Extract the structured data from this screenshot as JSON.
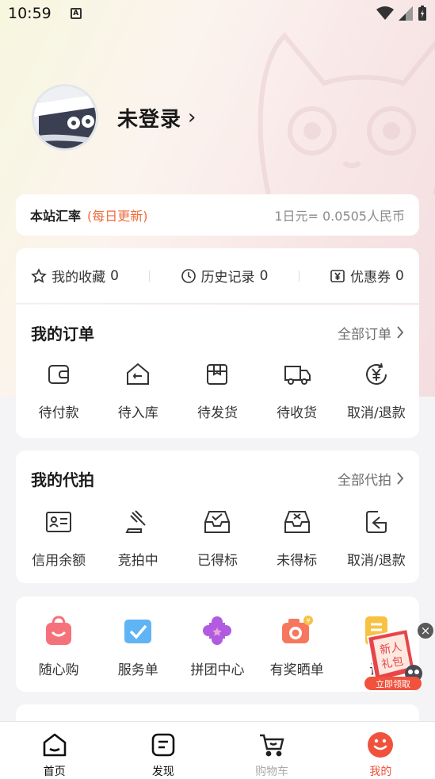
{
  "status_bar": {
    "time": "10:59",
    "badge": "A"
  },
  "profile": {
    "login_label": "未登录",
    "chevron": "›"
  },
  "rate": {
    "title": "本站汇率",
    "hint": "(每日更新)",
    "value": "1日元= 0.0505人民币"
  },
  "quick_links": [
    {
      "label": "我的收藏",
      "count": "0",
      "icon": "star-icon"
    },
    {
      "label": "历史记录",
      "count": "0",
      "icon": "clock-icon"
    },
    {
      "label": "优惠券",
      "count": "0",
      "icon": "coupon-icon"
    }
  ],
  "orders": {
    "title": "我的订单",
    "more": "全部订单",
    "items": [
      {
        "label": "待付款",
        "icon": "wallet-icon"
      },
      {
        "label": "待入库",
        "icon": "warehouse-icon"
      },
      {
        "label": "待发货",
        "icon": "box-icon"
      },
      {
        "label": "待收货",
        "icon": "truck-icon"
      },
      {
        "label": "取消/退款",
        "icon": "refund-icon"
      }
    ]
  },
  "bids": {
    "title": "我的代拍",
    "more": "全部代拍",
    "items": [
      {
        "label": "信用余额",
        "icon": "id-card-icon"
      },
      {
        "label": "竞拍中",
        "icon": "gavel-icon"
      },
      {
        "label": "已得标",
        "icon": "inbox-check-icon"
      },
      {
        "label": "未得标",
        "icon": "inbox-x-icon"
      },
      {
        "label": "取消/退款",
        "icon": "return-icon"
      }
    ]
  },
  "tools": [
    {
      "label": "随心购",
      "icon": "bag-icon",
      "color": "#f2575c"
    },
    {
      "label": "服务单",
      "icon": "check-card-icon",
      "color": "#4aa6f2"
    },
    {
      "label": "拼团中心",
      "icon": "puzzle-icon",
      "color": "#a14fd6"
    },
    {
      "label": "有奖晒单",
      "icon": "camera-icon",
      "color": "#f46c4f"
    },
    {
      "label": "评",
      "icon": "doc-icon",
      "color": "#f5b731"
    }
  ],
  "promo": {
    "title": "新人礼包",
    "action": "立即领取",
    "close": "×"
  },
  "tabbar": [
    {
      "label": "首页",
      "icon": "home-icon"
    },
    {
      "label": "发现",
      "icon": "discover-icon"
    },
    {
      "label": "购物车",
      "icon": "cart-icon"
    },
    {
      "label": "我的",
      "icon": "profile-face-icon"
    }
  ],
  "colors": {
    "accent": "#f0523c",
    "rate_hint": "#f06a3a"
  }
}
